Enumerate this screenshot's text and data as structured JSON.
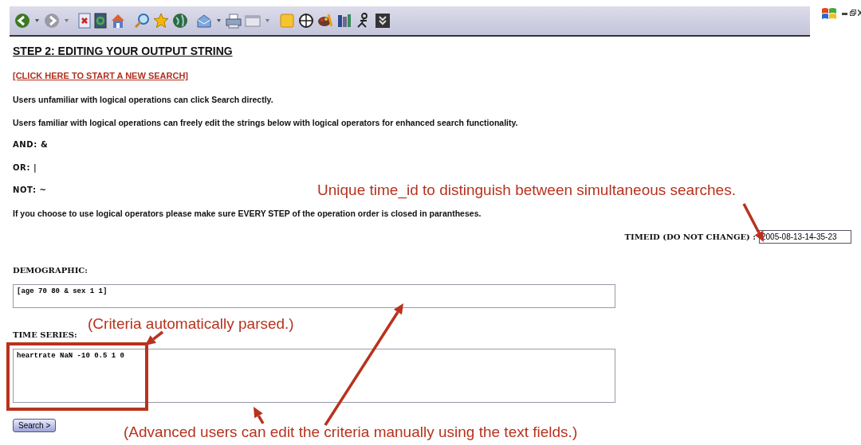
{
  "page": {
    "heading": "STEP 2: EDITING YOUR OUTPUT STRING",
    "link": "[CLICK HERE TO START A NEW SEARCH]",
    "lines": [
      {
        "kind": "paragraph",
        "text": "Users unfamiliar with logical operations can click Search directly."
      },
      {
        "kind": "paragraph",
        "text": "Users familiar with logical operations can freely edit the strings below with logical operators for enhanced search functionality."
      },
      {
        "kind": "operator",
        "text": "AND: &"
      },
      {
        "kind": "operator",
        "text": "OR: |"
      },
      {
        "kind": "operator",
        "text": "NOT: ~"
      },
      {
        "kind": "paragraph",
        "text": "If you choose to use logical operators please make sure EVERY STEP of the operation order is closed in parantheses."
      }
    ],
    "timeid": {
      "label": "TIMEID (DO NOT CHANGE) :",
      "value": "2005-08-13-14-35-23"
    },
    "fields": [
      {
        "label": "DEMOGRAPHIC:",
        "value": "[age 70 80 & sex 1 1]",
        "kind": "short"
      },
      {
        "label": "TIME SERIES:",
        "value": "heartrate NaN -10 0.5 1 0",
        "kind": "tall"
      }
    ],
    "button": "Search >"
  },
  "annotations": [
    {
      "text": "Unique time_id to distinguish between simultaneous searches."
    },
    {
      "text": "(Criteria automatically parsed.)"
    },
    {
      "text": "(Advanced users can edit the criteria manually using the text fields.)"
    }
  ]
}
